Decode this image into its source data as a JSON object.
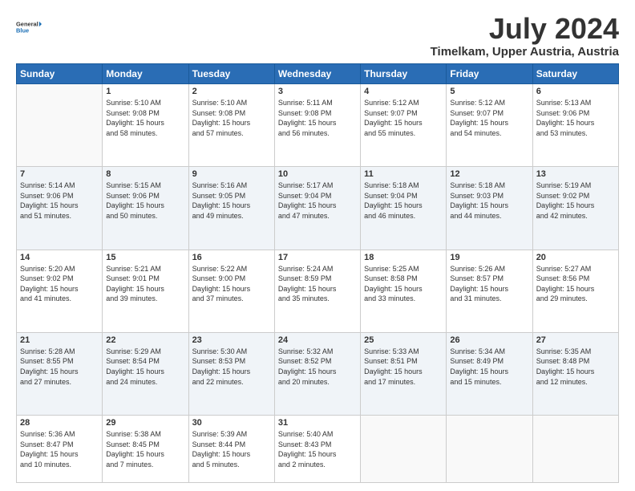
{
  "logo": {
    "line1": "General",
    "line2": "Blue"
  },
  "title": "July 2024",
  "subtitle": "Timelkam, Upper Austria, Austria",
  "weekdays": [
    "Sunday",
    "Monday",
    "Tuesday",
    "Wednesday",
    "Thursday",
    "Friday",
    "Saturday"
  ],
  "weeks": [
    [
      {
        "day": "",
        "info": ""
      },
      {
        "day": "1",
        "info": "Sunrise: 5:10 AM\nSunset: 9:08 PM\nDaylight: 15 hours\nand 58 minutes."
      },
      {
        "day": "2",
        "info": "Sunrise: 5:10 AM\nSunset: 9:08 PM\nDaylight: 15 hours\nand 57 minutes."
      },
      {
        "day": "3",
        "info": "Sunrise: 5:11 AM\nSunset: 9:08 PM\nDaylight: 15 hours\nand 56 minutes."
      },
      {
        "day": "4",
        "info": "Sunrise: 5:12 AM\nSunset: 9:07 PM\nDaylight: 15 hours\nand 55 minutes."
      },
      {
        "day": "5",
        "info": "Sunrise: 5:12 AM\nSunset: 9:07 PM\nDaylight: 15 hours\nand 54 minutes."
      },
      {
        "day": "6",
        "info": "Sunrise: 5:13 AM\nSunset: 9:06 PM\nDaylight: 15 hours\nand 53 minutes."
      }
    ],
    [
      {
        "day": "7",
        "info": "Sunrise: 5:14 AM\nSunset: 9:06 PM\nDaylight: 15 hours\nand 51 minutes."
      },
      {
        "day": "8",
        "info": "Sunrise: 5:15 AM\nSunset: 9:06 PM\nDaylight: 15 hours\nand 50 minutes."
      },
      {
        "day": "9",
        "info": "Sunrise: 5:16 AM\nSunset: 9:05 PM\nDaylight: 15 hours\nand 49 minutes."
      },
      {
        "day": "10",
        "info": "Sunrise: 5:17 AM\nSunset: 9:04 PM\nDaylight: 15 hours\nand 47 minutes."
      },
      {
        "day": "11",
        "info": "Sunrise: 5:18 AM\nSunset: 9:04 PM\nDaylight: 15 hours\nand 46 minutes."
      },
      {
        "day": "12",
        "info": "Sunrise: 5:18 AM\nSunset: 9:03 PM\nDaylight: 15 hours\nand 44 minutes."
      },
      {
        "day": "13",
        "info": "Sunrise: 5:19 AM\nSunset: 9:02 PM\nDaylight: 15 hours\nand 42 minutes."
      }
    ],
    [
      {
        "day": "14",
        "info": "Sunrise: 5:20 AM\nSunset: 9:02 PM\nDaylight: 15 hours\nand 41 minutes."
      },
      {
        "day": "15",
        "info": "Sunrise: 5:21 AM\nSunset: 9:01 PM\nDaylight: 15 hours\nand 39 minutes."
      },
      {
        "day": "16",
        "info": "Sunrise: 5:22 AM\nSunset: 9:00 PM\nDaylight: 15 hours\nand 37 minutes."
      },
      {
        "day": "17",
        "info": "Sunrise: 5:24 AM\nSunset: 8:59 PM\nDaylight: 15 hours\nand 35 minutes."
      },
      {
        "day": "18",
        "info": "Sunrise: 5:25 AM\nSunset: 8:58 PM\nDaylight: 15 hours\nand 33 minutes."
      },
      {
        "day": "19",
        "info": "Sunrise: 5:26 AM\nSunset: 8:57 PM\nDaylight: 15 hours\nand 31 minutes."
      },
      {
        "day": "20",
        "info": "Sunrise: 5:27 AM\nSunset: 8:56 PM\nDaylight: 15 hours\nand 29 minutes."
      }
    ],
    [
      {
        "day": "21",
        "info": "Sunrise: 5:28 AM\nSunset: 8:55 PM\nDaylight: 15 hours\nand 27 minutes."
      },
      {
        "day": "22",
        "info": "Sunrise: 5:29 AM\nSunset: 8:54 PM\nDaylight: 15 hours\nand 24 minutes."
      },
      {
        "day": "23",
        "info": "Sunrise: 5:30 AM\nSunset: 8:53 PM\nDaylight: 15 hours\nand 22 minutes."
      },
      {
        "day": "24",
        "info": "Sunrise: 5:32 AM\nSunset: 8:52 PM\nDaylight: 15 hours\nand 20 minutes."
      },
      {
        "day": "25",
        "info": "Sunrise: 5:33 AM\nSunset: 8:51 PM\nDaylight: 15 hours\nand 17 minutes."
      },
      {
        "day": "26",
        "info": "Sunrise: 5:34 AM\nSunset: 8:49 PM\nDaylight: 15 hours\nand 15 minutes."
      },
      {
        "day": "27",
        "info": "Sunrise: 5:35 AM\nSunset: 8:48 PM\nDaylight: 15 hours\nand 12 minutes."
      }
    ],
    [
      {
        "day": "28",
        "info": "Sunrise: 5:36 AM\nSunset: 8:47 PM\nDaylight: 15 hours\nand 10 minutes."
      },
      {
        "day": "29",
        "info": "Sunrise: 5:38 AM\nSunset: 8:45 PM\nDaylight: 15 hours\nand 7 minutes."
      },
      {
        "day": "30",
        "info": "Sunrise: 5:39 AM\nSunset: 8:44 PM\nDaylight: 15 hours\nand 5 minutes."
      },
      {
        "day": "31",
        "info": "Sunrise: 5:40 AM\nSunset: 8:43 PM\nDaylight: 15 hours\nand 2 minutes."
      },
      {
        "day": "",
        "info": ""
      },
      {
        "day": "",
        "info": ""
      },
      {
        "day": "",
        "info": ""
      }
    ]
  ]
}
